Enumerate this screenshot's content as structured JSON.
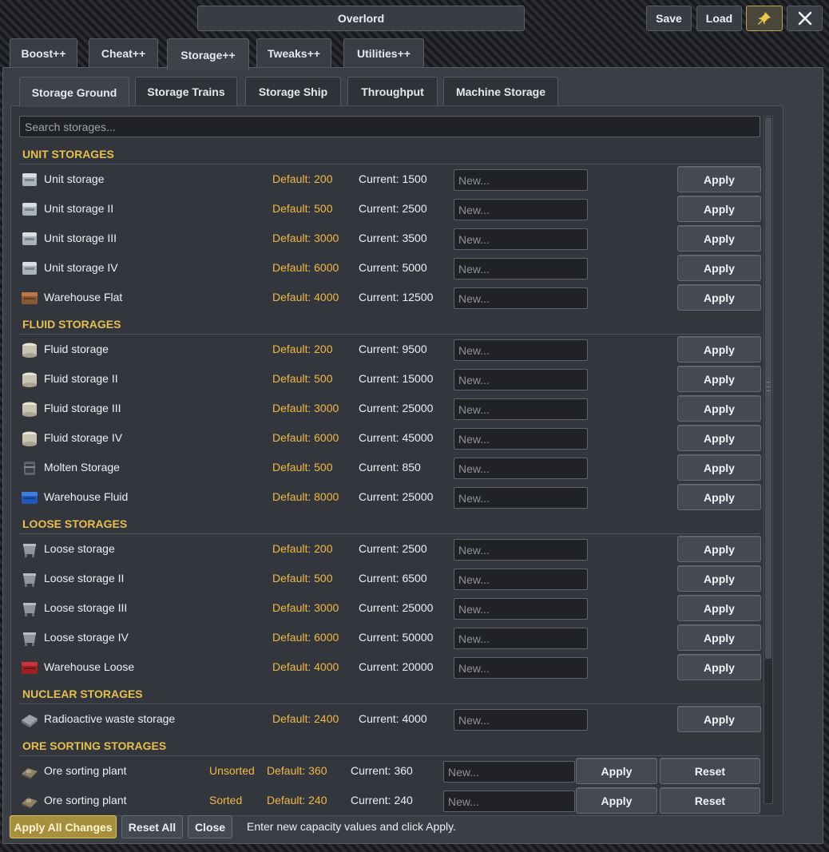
{
  "window": {
    "title": "Overlord",
    "save": "Save",
    "load": "Load",
    "pin_icon": "pin-icon",
    "close_icon": "close-icon"
  },
  "tabs": [
    {
      "label": "Boost++"
    },
    {
      "label": "Cheat++"
    },
    {
      "label": "Storage++",
      "active": true
    },
    {
      "label": "Tweaks++"
    },
    {
      "label": "Utilities++"
    }
  ],
  "subtabs": [
    {
      "label": "Storage Ground",
      "active": true
    },
    {
      "label": "Storage Trains"
    },
    {
      "label": "Storage Ship"
    },
    {
      "label": "Throughput"
    },
    {
      "label": "Machine Storage"
    }
  ],
  "search": {
    "placeholder": "Search storages..."
  },
  "input_placeholder": "New...",
  "apply_label": "Apply",
  "reset_label": "Reset",
  "sections": [
    {
      "title": "UNIT STORAGES",
      "rows": [
        {
          "name": "Unit storage",
          "default": "Default: 200",
          "current": "Current: 1500",
          "icon": "unit-storage-icon"
        },
        {
          "name": "Unit storage II",
          "default": "Default: 500",
          "current": "Current: 2500",
          "icon": "unit-storage-icon"
        },
        {
          "name": "Unit storage III",
          "default": "Default: 3000",
          "current": "Current: 3500",
          "icon": "unit-storage-icon"
        },
        {
          "name": "Unit storage IV",
          "default": "Default: 6000",
          "current": "Current: 5000",
          "icon": "unit-storage-icon"
        },
        {
          "name": "Warehouse Flat",
          "default": "Default: 4000",
          "current": "Current: 12500",
          "icon": "warehouse-flat-icon"
        }
      ]
    },
    {
      "title": "FLUID STORAGES",
      "rows": [
        {
          "name": "Fluid storage",
          "default": "Default: 200",
          "current": "Current: 9500",
          "icon": "fluid-storage-icon"
        },
        {
          "name": "Fluid storage II",
          "default": "Default: 500",
          "current": "Current: 15000",
          "icon": "fluid-storage-icon"
        },
        {
          "name": "Fluid storage III",
          "default": "Default: 3000",
          "current": "Current: 25000",
          "icon": "fluid-storage-icon"
        },
        {
          "name": "Fluid storage IV",
          "default": "Default: 6000",
          "current": "Current: 45000",
          "icon": "fluid-storage-icon"
        },
        {
          "name": "Molten Storage",
          "default": "Default: 500",
          "current": "Current: 850",
          "icon": "molten-storage-icon"
        },
        {
          "name": "Warehouse Fluid",
          "default": "Default: 8000",
          "current": "Current: 25000",
          "icon": "warehouse-fluid-icon"
        }
      ]
    },
    {
      "title": "LOOSE STORAGES",
      "rows": [
        {
          "name": "Loose storage",
          "default": "Default: 200",
          "current": "Current: 2500",
          "icon": "loose-storage-icon"
        },
        {
          "name": "Loose storage II",
          "default": "Default: 500",
          "current": "Current: 6500",
          "icon": "loose-storage-icon"
        },
        {
          "name": "Loose storage III",
          "default": "Default: 3000",
          "current": "Current: 25000",
          "icon": "loose-storage-icon"
        },
        {
          "name": "Loose storage IV",
          "default": "Default: 6000",
          "current": "Current: 50000",
          "icon": "loose-storage-icon"
        },
        {
          "name": "Warehouse Loose",
          "default": "Default: 4000",
          "current": "Current: 20000",
          "icon": "warehouse-loose-icon"
        }
      ]
    },
    {
      "title": "NUCLEAR STORAGES",
      "rows": [
        {
          "name": "Radioactive waste storage",
          "default": "Default: 2400",
          "current": "Current: 4000",
          "icon": "radioactive-storage-icon"
        }
      ]
    },
    {
      "title": "ORE SORTING STORAGES",
      "ore": true,
      "rows": [
        {
          "name": "Ore sorting plant",
          "status": "Unsorted",
          "default": "Default: 360",
          "current": "Current: 360",
          "icon": "ore-sorting-icon"
        },
        {
          "name": "Ore sorting plant",
          "status": "Sorted",
          "default": "Default: 240",
          "current": "Current: 240",
          "icon": "ore-sorting-icon"
        }
      ]
    }
  ],
  "footer": {
    "apply_all": "Apply All Changes",
    "reset_all": "Reset All",
    "close": "Close",
    "hint": "Enter new capacity values and click Apply."
  },
  "colors": {
    "accent": "#e7bf4e",
    "default_value": "#f0b948",
    "background": "#3b3e45"
  }
}
